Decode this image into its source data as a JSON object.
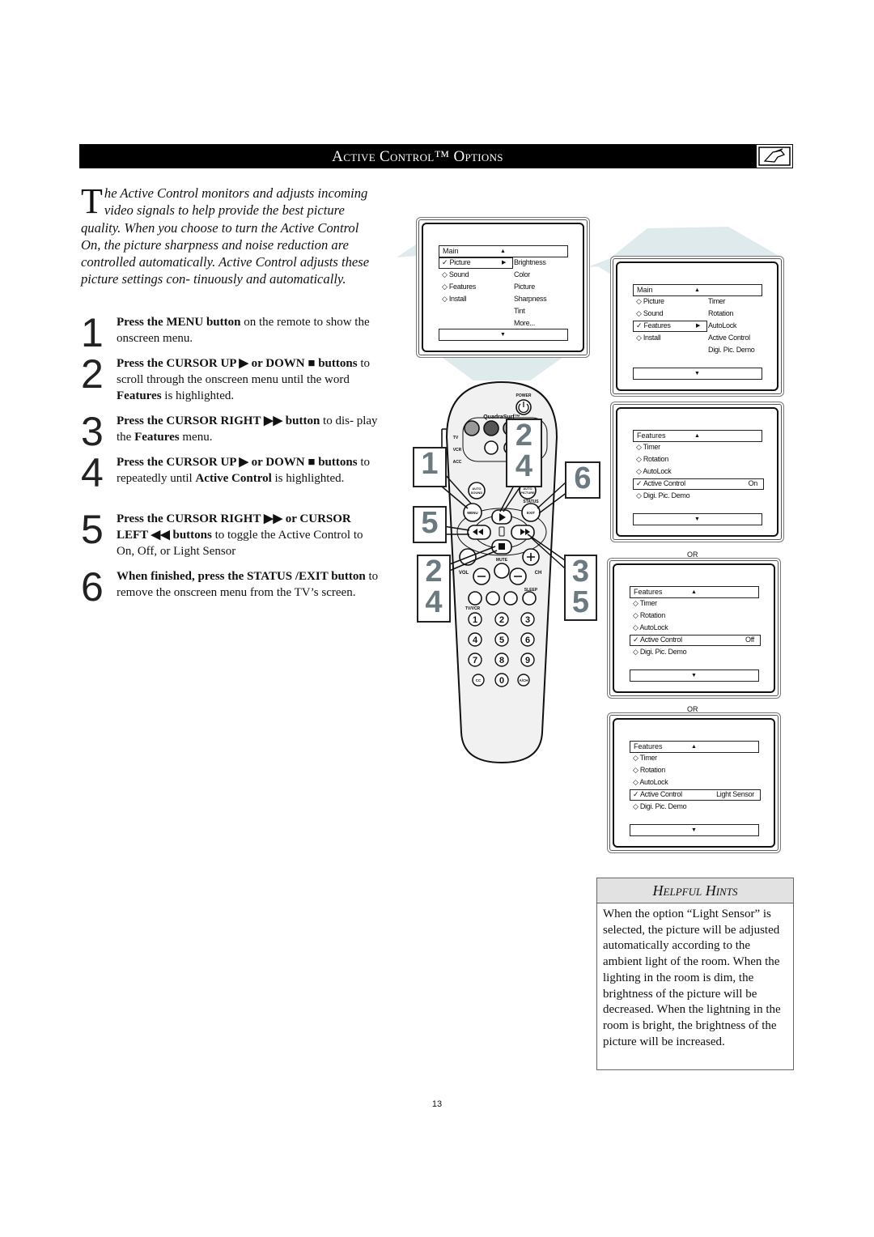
{
  "header": {
    "title": "Active Control™ Options",
    "icon": "remote-hand-icon"
  },
  "intro": {
    "dropcap": "T",
    "text": "he Active Control monitors and adjusts incoming video signals to help provide the best picture quality. When you choose to turn the Active Control On, the picture sharpness and noise reduction are controlled automatically. Active Control adjusts these picture settings con- tinuously and automatically."
  },
  "steps": [
    {
      "num": "1",
      "parts": [
        "Press the MENU button",
        " on the remote to show the onscreen menu."
      ]
    },
    {
      "num": "2",
      "parts": [
        "Press the CURSOR UP ▶ or DOWN ■ buttons",
        " to scroll through the onscreen menu until the word ",
        "Features",
        " is highlighted."
      ]
    },
    {
      "num": "3",
      "parts": [
        "Press the CURSOR RIGHT ▶▶ button",
        " to dis- play the ",
        "Features",
        " menu."
      ]
    },
    {
      "num": "4",
      "parts": [
        "Press the CURSOR UP ▶ or DOWN ■ buttons",
        " to repeatedly until ",
        "Active Control",
        " is highlighted."
      ]
    },
    {
      "num": "5",
      "parts": [
        "Press the CURSOR RIGHT ▶▶ or CURSOR LEFT ◀◀ buttons",
        " to toggle the Active Control to On, Off, or Light Sensor"
      ]
    },
    {
      "num": "6",
      "parts": [
        "When finished, press the STATUS /EXIT button",
        " to remove the onscreen menu from the TV’s screen."
      ]
    }
  ],
  "screens": [
    {
      "title": "Main",
      "hlWidth": 90,
      "rows": [
        {
          "mark": "check",
          "label": "Picture",
          "hl": true,
          "arrow": true,
          "right": "Brightness"
        },
        {
          "mark": "diamond",
          "label": "Sound",
          "right": "Color"
        },
        {
          "mark": "diamond",
          "label": "Features",
          "right": "Picture"
        },
        {
          "mark": "diamond",
          "label": "Install",
          "right": "Sharpness"
        },
        {
          "label": "",
          "right": "Tint"
        },
        {
          "label": "",
          "right": "More..."
        }
      ]
    },
    {
      "title": "Main",
      "hlWidth": 90,
      "rows": [
        {
          "mark": "diamond",
          "label": "Picture",
          "right": "Timer"
        },
        {
          "mark": "diamond",
          "label": "Sound",
          "right": "Rotation"
        },
        {
          "mark": "check",
          "label": "Features",
          "hl": true,
          "arrow": true,
          "right": "AutoLock"
        },
        {
          "mark": "diamond",
          "label": "Install",
          "right": "Active Control"
        },
        {
          "label": "",
          "right": "Digi. Pic. Demo"
        }
      ]
    },
    {
      "title": "Features",
      "hlWidth": 160,
      "rows": [
        {
          "mark": "diamond",
          "label": "Timer"
        },
        {
          "mark": "diamond",
          "label": "Rotation"
        },
        {
          "mark": "diamond",
          "label": "AutoLock"
        },
        {
          "mark": "check",
          "label": "Active Control",
          "hl": true,
          "value": "On"
        },
        {
          "mark": "diamond",
          "label": "Digi. Pic. Demo"
        }
      ]
    },
    {
      "title": "Features",
      "hlWidth": 160,
      "rows": [
        {
          "mark": "diamond",
          "label": "Timer"
        },
        {
          "mark": "diamond",
          "label": "Rotation"
        },
        {
          "mark": "diamond",
          "label": "AutoLock"
        },
        {
          "mark": "check",
          "label": "Active Control",
          "hl": true,
          "value": "Off"
        },
        {
          "mark": "diamond",
          "label": "Digi. Pic. Demo"
        }
      ]
    },
    {
      "title": "Features",
      "hlWidth": 160,
      "rows": [
        {
          "mark": "diamond",
          "label": "Timer"
        },
        {
          "mark": "diamond",
          "label": "Rotation"
        },
        {
          "mark": "diamond",
          "label": "AutoLock"
        },
        {
          "mark": "check",
          "label": "Active Control",
          "hl": true,
          "value": "Light Sensor"
        },
        {
          "mark": "diamond",
          "label": "Digi. Pic. Demo"
        }
      ]
    }
  ],
  "or_label": "OR",
  "remote": {
    "power": "POWER",
    "brand": "QuadraSurf™",
    "tv": "TV",
    "vcr": "VCR",
    "acc": "ACC",
    "auto_sound": [
      "AUTO",
      "SOUND"
    ],
    "auto_picture": [
      "AUTO",
      "PICTURE"
    ],
    "status": "STATUS",
    "menu": "MENU",
    "exit": "EXIT",
    "mute": "MUTE",
    "vol": "VOL",
    "ch": "CH",
    "sleep": "SLEEP",
    "tvvcr": "TV/VCR",
    "digits": [
      "1",
      "2",
      "3",
      "4",
      "5",
      "6",
      "7",
      "8",
      "9"
    ],
    "cc": "CC",
    "zero": "0",
    "ach": "A/CH"
  },
  "callouts": [
    "1",
    "2\n4",
    "6",
    "5",
    "2\n4",
    "3\n5"
  ],
  "hints": {
    "title": "Helpful Hints",
    "text": "When the option “Light Sensor” is selected, the picture will be adjusted automatically according to the ambient light of the room. When the lighting in the room is dim, the brightness of the picture will be decreased.  When the lightning in the room is bright, the brightness of the picture will be increased."
  },
  "page_number": "13",
  "colors": {
    "cone": "#d8e5e7",
    "callout_digit": "#6a7a80",
    "header_bg": "#000000"
  }
}
